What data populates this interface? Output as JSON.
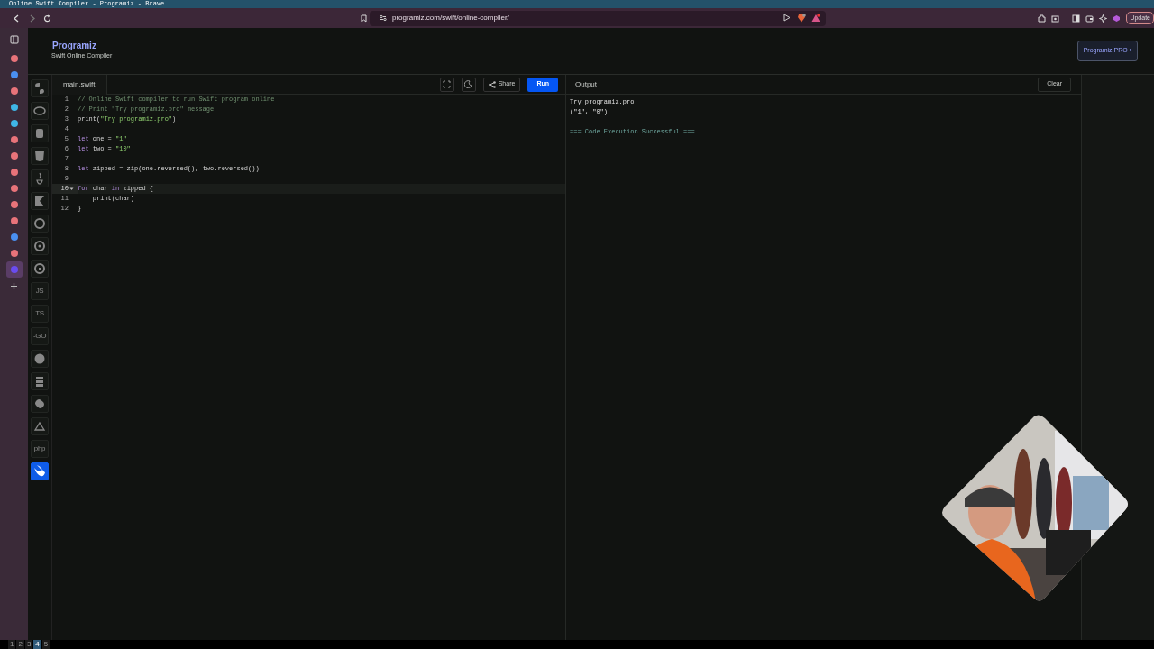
{
  "window": {
    "title": "Online Swift Compiler - Programiz - Brave"
  },
  "browser": {
    "url": "programiz.com/swift/online-compiler/",
    "update_label": "Update",
    "workspaces": [
      {
        "label": "1",
        "selected": false
      },
      {
        "label": "2",
        "selected": false
      },
      {
        "label": "3",
        "selected": false
      },
      {
        "label": "4",
        "selected": true
      },
      {
        "label": "5",
        "selected": false
      }
    ],
    "sidebar": [
      {
        "color": "#e8737a",
        "selected": false
      },
      {
        "color": "#4a8ff0",
        "selected": false
      },
      {
        "color": "#e8737a",
        "selected": false
      },
      {
        "color": "#3fb6e6",
        "selected": false
      },
      {
        "color": "#3fb6e6",
        "selected": false
      },
      {
        "color": "#e8737a",
        "selected": false
      },
      {
        "color": "#e8737a",
        "selected": false
      },
      {
        "color": "#e8737a",
        "selected": false
      },
      {
        "color": "#e8737a",
        "selected": false
      },
      {
        "color": "#e8737a",
        "selected": false
      },
      {
        "color": "#e8737a",
        "selected": false
      },
      {
        "color": "#4a8ff0",
        "selected": false
      },
      {
        "color": "#e8737a",
        "selected": false
      },
      {
        "color": "#6a4cf0",
        "selected": true
      }
    ]
  },
  "header": {
    "logo": "Programiz",
    "subtitle": "Swift Online Compiler",
    "pro_button": "Programiz PRO ›"
  },
  "languages": [
    {
      "kind": "icon",
      "selected": false
    },
    {
      "kind": "icon",
      "selected": false
    },
    {
      "kind": "icon",
      "selected": false
    },
    {
      "kind": "icon",
      "selected": false
    },
    {
      "kind": "icon",
      "selected": false
    },
    {
      "kind": "icon",
      "selected": false
    },
    {
      "kind": "icon",
      "selected": false
    },
    {
      "kind": "icon",
      "selected": false
    },
    {
      "kind": "icon",
      "selected": false
    },
    {
      "kind": "text",
      "label": "JS",
      "selected": false
    },
    {
      "kind": "text",
      "label": "TS",
      "selected": false
    },
    {
      "kind": "text",
      "label": "-GO",
      "selected": false
    },
    {
      "kind": "icon",
      "selected": false
    },
    {
      "kind": "icon",
      "selected": false
    },
    {
      "kind": "icon",
      "selected": false
    },
    {
      "kind": "icon",
      "selected": false
    },
    {
      "kind": "text",
      "label": "php",
      "selected": false
    },
    {
      "kind": "icon",
      "selected": true
    }
  ],
  "editor": {
    "file_tab": "main.swift",
    "share_button": "Share",
    "run_button": "Run",
    "lines": [
      {
        "number": "1",
        "foldable": false,
        "active": false,
        "tokens": [
          {
            "kind": "comment",
            "text": "// Online Swift compiler to run Swift program online"
          }
        ]
      },
      {
        "number": "2",
        "foldable": false,
        "active": false,
        "tokens": [
          {
            "kind": "comment",
            "text": "// Print \"Try programiz.pro\" message"
          }
        ]
      },
      {
        "number": "3",
        "foldable": false,
        "active": false,
        "tokens": [
          {
            "kind": "plain",
            "text": "print("
          },
          {
            "kind": "string",
            "text": "\"Try programiz.pro\""
          },
          {
            "kind": "plain",
            "text": ")"
          }
        ]
      },
      {
        "number": "4",
        "foldable": false,
        "active": false
      },
      {
        "number": "5",
        "foldable": false,
        "active": false,
        "tokens": [
          {
            "kind": "keyword",
            "text": "let"
          },
          {
            "kind": "plain",
            "text": " one = "
          },
          {
            "kind": "string",
            "text": "\"1\""
          }
        ]
      },
      {
        "number": "6",
        "foldable": false,
        "active": false,
        "tokens": [
          {
            "kind": "keyword",
            "text": "let"
          },
          {
            "kind": "plain",
            "text": " two = "
          },
          {
            "kind": "string",
            "text": "\"10\""
          }
        ]
      },
      {
        "number": "7",
        "foldable": false,
        "active": false
      },
      {
        "number": "8",
        "foldable": false,
        "active": false,
        "tokens": [
          {
            "kind": "keyword",
            "text": "let"
          },
          {
            "kind": "plain",
            "text": " zipped = zip(one.reversed(), two.reversed())"
          }
        ]
      },
      {
        "number": "9",
        "foldable": false,
        "active": false
      },
      {
        "number": "10",
        "foldable": true,
        "active": true,
        "tokens": [
          {
            "kind": "keyword",
            "text": "for"
          },
          {
            "kind": "plain",
            "text": " char "
          },
          {
            "kind": "keyword",
            "text": "in"
          },
          {
            "kind": "plain",
            "text": " zipped {"
          }
        ]
      },
      {
        "number": "11",
        "foldable": false,
        "active": false,
        "tokens": [
          {
            "kind": "plain",
            "text": "    print(char)"
          }
        ]
      },
      {
        "number": "12",
        "foldable": false,
        "active": false,
        "tokens": [
          {
            "kind": "plain",
            "text": "}"
          }
        ]
      }
    ]
  },
  "output": {
    "title": "Output",
    "clear_button": "Clear",
    "lines": [
      {
        "kind": "plain",
        "text": "Try programiz.pro"
      },
      {
        "kind": "plain",
        "text": "(\"1\", \"0\")"
      },
      {
        "kind": "blank"
      },
      {
        "kind": "success",
        "text": "=== Code Execution Successful ==="
      }
    ]
  }
}
